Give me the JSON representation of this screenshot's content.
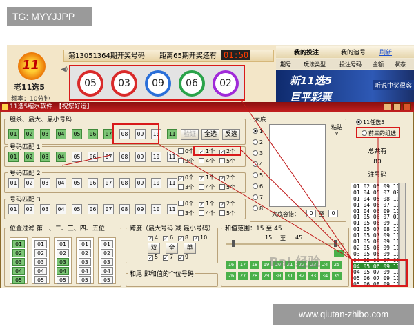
{
  "watermark_top": "TG: MYYJJPP",
  "watermark_bottom": "www.qiutan-zhibo.com",
  "lottery": {
    "logo_num": "11",
    "name": "老11选5",
    "freq": "频率：10分钟",
    "draw_label": "第13051364期开奖号码",
    "countdown_label": "距离65期开奖还有",
    "countdown": "01:50",
    "balls": [
      "05",
      "03",
      "09",
      "06",
      "02"
    ],
    "ball_colors": [
      "#d92a2a",
      "#d92a2a",
      "#2a6fd9",
      "#2aa34a",
      "#a02ad9"
    ],
    "tabs": [
      "我的投注",
      "我的追号",
      "刷新"
    ],
    "heads": [
      "期号",
      "玩法类型",
      "投注号码",
      "金额",
      "状态"
    ],
    "banner1": "新11选5",
    "banner2": "听说中奖很容",
    "banner3": "巨平彩票"
  },
  "window": {
    "title": "11选5缩水软件　【祝您好运】",
    "kill_label": "胆杀、最大、最小号码",
    "kill_row": [
      "01",
      "02",
      "03",
      "04",
      "05",
      "06",
      "07",
      "08",
      "09",
      "10",
      "11"
    ],
    "kill_green": [
      true,
      true,
      true,
      true,
      true,
      true,
      true,
      false,
      false,
      false,
      true
    ],
    "btn_verify": "验证",
    "btn_all": "全选",
    "btn_invert": "反选",
    "match1_label": "号码匹配 1",
    "match1_row": [
      "01",
      "02",
      "03",
      "04",
      "05",
      "06",
      "07",
      "08",
      "09",
      "10",
      "11"
    ],
    "match1_green": [
      true,
      true,
      true,
      true,
      false,
      false,
      false,
      false,
      false,
      false,
      false
    ],
    "match2_label": "号码匹配 2",
    "match2_row": [
      "01",
      "02",
      "03",
      "04",
      "05",
      "06",
      "07",
      "08",
      "09",
      "10",
      "11"
    ],
    "match3_label": "号码匹配 3",
    "match3_row": [
      "01",
      "02",
      "03",
      "04",
      "05",
      "06",
      "07",
      "08",
      "09",
      "10",
      "11"
    ],
    "cnt": [
      "0个",
      "1个",
      "2个",
      "3个",
      "4个",
      "5个"
    ],
    "dan_label": "大底",
    "paste_label": "粘贴",
    "dan_opts": [
      "1",
      "2",
      "3",
      "4",
      "5",
      "6",
      "7",
      "8"
    ],
    "dan_tol_label": "大底容错：",
    "dan_tol_from": "0",
    "dan_tol_to": "0",
    "dan_tol_sep": "至",
    "mode1": "11任选5",
    "mode2": "前三的组选",
    "count_label": "总共有",
    "count": "80",
    "bet_label": "注号码",
    "pos_label": "位置过滤  第一、二、三、四、五位",
    "pos_nums": [
      "01",
      "02",
      "03",
      "04",
      "05"
    ],
    "span_label": "跨度（最大号码 减 最小号码）",
    "span_vals": [
      "4",
      "6",
      "8",
      "10",
      "5",
      "7",
      "9"
    ],
    "span_btns": [
      "双",
      "全",
      "单"
    ],
    "sum_label": "和值范围：15 至 45",
    "sum_from": "15",
    "sum_sep": "至",
    "sum_to": "45",
    "sum_nums": [
      "16",
      "17",
      "18",
      "19",
      "20",
      "21",
      "22",
      "23",
      "24",
      "25",
      "26",
      "27",
      "28",
      "29",
      "30",
      "31",
      "32",
      "33",
      "34",
      "35"
    ],
    "tail_label": "和尾 即和值的个位号码",
    "results": [
      "01 02 05 09 11",
      "01 04 05 07 09",
      "01 04 05 08 11",
      "01 04 06 07 11",
      "01 04 06 09 11",
      "01 05 06 07 09",
      "01 05 06 09 11",
      "01 05 07 08 11",
      "01 05 07 09 11",
      "01 05 08 09 11",
      "02 05 06 09 11",
      "03 05 06 09 11",
      "04 05 06 07 09",
      "04 05 06 09 11",
      "04 05 07 09 11",
      "05 06 07 09 11",
      "05 06 08 09 11"
    ],
    "selected_row": 13,
    "baidu": "Bai 经验"
  }
}
